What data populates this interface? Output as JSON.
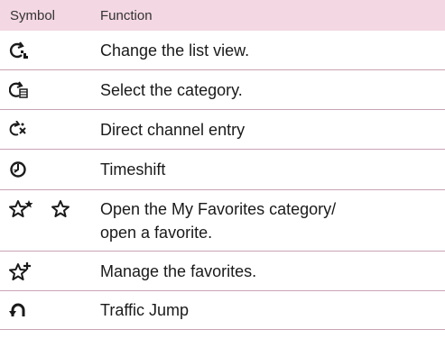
{
  "header": {
    "symbol": "Symbol",
    "function": "Function"
  },
  "rows": [
    {
      "icon": "change-list-view-icon",
      "text": "Change the list view."
    },
    {
      "icon": "select-category-icon",
      "text": "Select the category."
    },
    {
      "icon": "direct-channel-entry-icon",
      "text": "Direct channel entry"
    },
    {
      "icon": "timeshift-icon",
      "text": "Timeshift"
    },
    {
      "icon": "favorites-icons",
      "text": "Open the My Favorites category/\nopen a favorite."
    },
    {
      "icon": "manage-favorites-icon",
      "text": "Manage the favorites."
    },
    {
      "icon": "traffic-jump-icon",
      "text": "Traffic Jump"
    }
  ],
  "colors": {
    "header_bg": "#f3d7e2",
    "rule": "#c9a3b4",
    "text": "#1a1a1a"
  }
}
